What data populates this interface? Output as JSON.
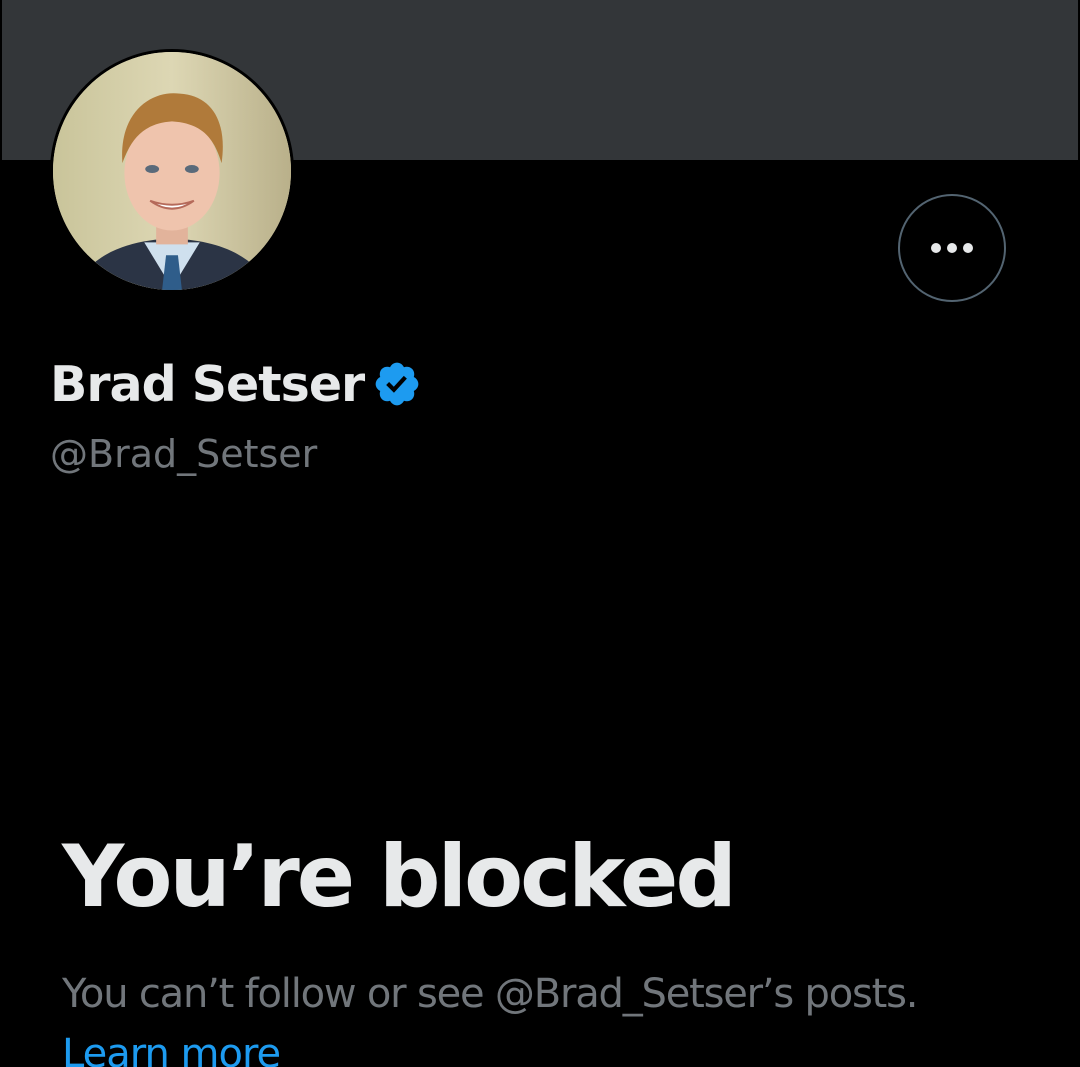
{
  "profile": {
    "display_name": "Brad Setser",
    "handle": "@Brad_Setser",
    "verified_icon": "verified-badge-icon",
    "more_icon": "more-horizontal-icon"
  },
  "blocked": {
    "title": "You’re blocked",
    "message": "You can’t follow or see @Brad_Setser’s posts.",
    "link_label": "Learn more"
  },
  "colors": {
    "background": "#000000",
    "banner": "#333639",
    "primary_text": "#e7e9ea",
    "secondary_text": "#71767b",
    "accent": "#1d9bf0",
    "button_border": "#536471"
  }
}
